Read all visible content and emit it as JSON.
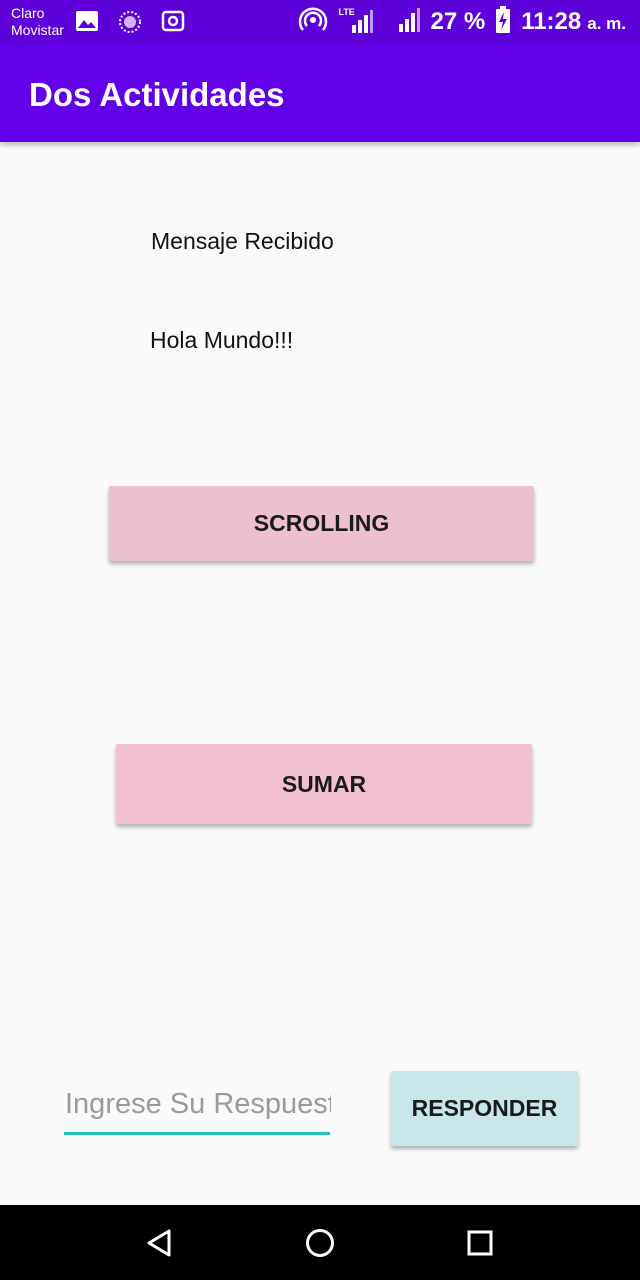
{
  "status_bar": {
    "carrier_line1": "Claro",
    "carrier_line2": "Movistar",
    "battery_percent": "27 %",
    "time": "11:28",
    "time_suffix": "a. m.",
    "network_label": "LTE",
    "icons": [
      "image-icon",
      "sync-icon",
      "camera-icon",
      "hotspot-icon",
      "signal-icon",
      "signal-icon",
      "battery-charging-icon"
    ]
  },
  "app_bar": {
    "title": "Dos Actividades"
  },
  "main": {
    "message_heading": "Mensaje Recibido",
    "message_text": "Hola Mundo!!!",
    "scrolling_button": "SCROLLING",
    "sumar_button": "SUMAR",
    "response_placeholder": "Ingrese Su Respuesta",
    "response_value": "",
    "responder_button": "RESPONDER"
  },
  "nav_bar": {
    "icons": [
      "back-icon",
      "home-icon",
      "recents-icon"
    ]
  },
  "colors": {
    "status_bar": "#5e00d8",
    "app_bar": "#6200ea",
    "background": "#fafafa",
    "scrolling_button": "#ecc0cc",
    "sumar_button": "#f1c1cf",
    "responder_button": "#c9e6ea",
    "input_underline": "#1ec8c2"
  }
}
